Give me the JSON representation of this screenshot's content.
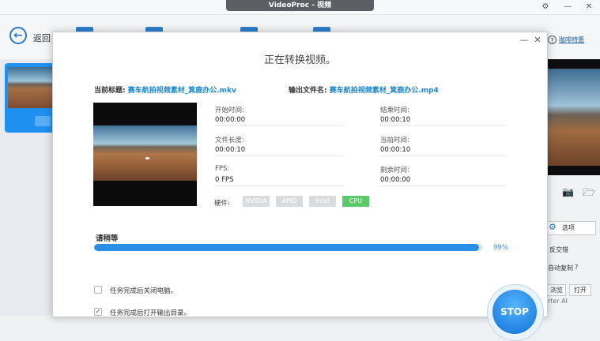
{
  "app": {
    "window_title": "VideoProc - 视频",
    "back_label": "返回",
    "help_label": "咖啡特惠"
  },
  "right_panel": {
    "options_label": "选项",
    "deinterlace": "反交错",
    "auto_copy": "自动复制",
    "help_mark": "?",
    "browse_label": "浏览",
    "open_label": "打开",
    "footer_text": "rter AI"
  },
  "dialog": {
    "title": "正在转换视频。",
    "source_label": "当前标题:",
    "source_name": "赛车航拍视频素材_箕鹿办公.mkv",
    "output_label": "输出文件名:",
    "output_name": "赛车航拍视频素材_箕鹿办公.mp4",
    "info": {
      "start_time_label": "开始时间:",
      "start_time": "00:00:00",
      "end_time_label": "结束时间:",
      "end_time": "00:00:10",
      "file_length_label": "文件长度:",
      "file_length": "00:00:10",
      "current_time_label": "当前时间:",
      "current_time": "00:00:10",
      "fps_label": "FPS:",
      "fps": "0 FPS",
      "remaining_label": "剩余时间:",
      "remaining": "00:00:00"
    },
    "hardware_label": "硬件:",
    "hardware": [
      {
        "label": "NVIDIA",
        "active": false
      },
      {
        "label": "AMD",
        "active": false
      },
      {
        "label": "Intel",
        "active": false
      },
      {
        "label": "CPU",
        "active": true
      }
    ],
    "status_text": "请稍等",
    "progress_percent": 99,
    "progress_label": "99%",
    "shutdown_label": "任务完成后关闭电脑。",
    "shutdown_checked": false,
    "open_folder_label": "任务完成后打开输出目录。",
    "open_folder_checked": true,
    "stop_label": "STOP"
  },
  "colors": {
    "accent": "#1a86cf",
    "progress": "#2c8fe6",
    "active_hw": "#5cc96a"
  }
}
